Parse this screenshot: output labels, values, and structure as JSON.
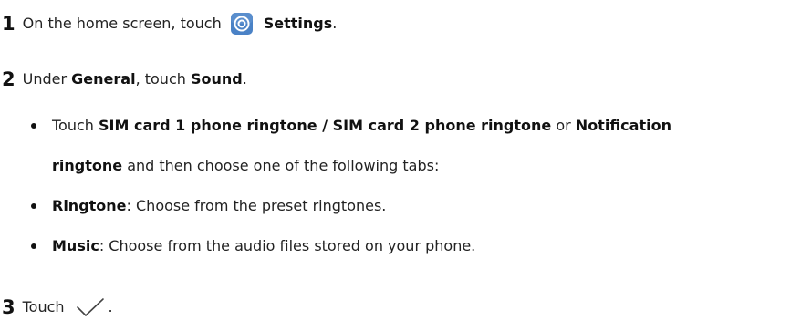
{
  "steps": [
    {
      "number": "1",
      "parts": [
        "On the home screen, touch",
        "Settings",
        "."
      ],
      "icon": "settings-icon"
    },
    {
      "number": "2",
      "parts": [
        "Under",
        "General",
        ", touch",
        "Sound",
        "."
      ],
      "bullets": [
        {
          "line1": [
            "Touch",
            "SIM card 1 phone ringtone / SIM card 2 phone ringtone",
            "or",
            "Notification"
          ],
          "line2": [
            "ringtone",
            "and then choose one of the following tabs:"
          ]
        },
        {
          "parts": [
            "Ringtone",
            ": Choose from the preset ringtones."
          ]
        },
        {
          "parts": [
            "Music",
            ": Choose from the audio files stored on your phone."
          ]
        }
      ]
    },
    {
      "number": "3",
      "parts": [
        "Touch",
        "."
      ],
      "icon": "check-icon"
    }
  ],
  "colors": {
    "icon_blue": "#3b74b8",
    "text": "#222222"
  }
}
